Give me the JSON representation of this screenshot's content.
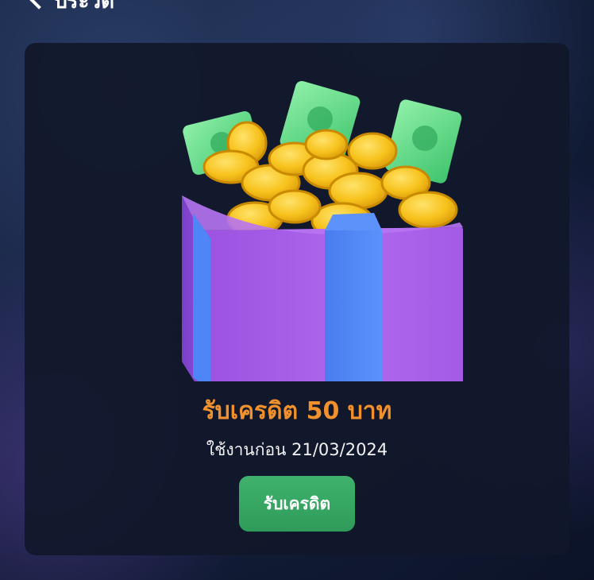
{
  "header": {
    "title": "ประวัติ"
  },
  "card": {
    "reward_title": "รับเครดิต 50 บาท",
    "expiry_text": "ใช้งานก่อน 21/03/2024",
    "claim_button_label": "รับเครดิต",
    "gift_image": "gift-box-with-coins-and-cash-icon"
  },
  "colors": {
    "reward_title": "#f0912d",
    "claim_button": "#3aa865",
    "card_bg": "#11182a",
    "gift_box": "#a45ae8",
    "gift_ribbon": "#4f86f7"
  }
}
